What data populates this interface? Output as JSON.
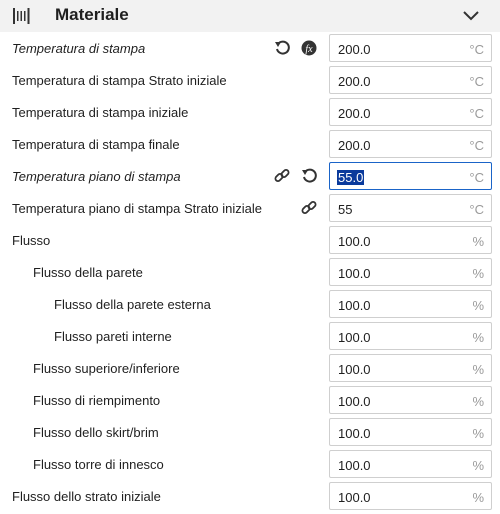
{
  "category": {
    "title": "Materiale",
    "icon": "spool-icon",
    "toggle_icon": "chevron-down-icon"
  },
  "settings": [
    {
      "label": "Temperatura di stampa",
      "value": "200.0",
      "unit": "°C",
      "italic": true,
      "icons": [
        "reset-icon",
        "function-icon"
      ]
    },
    {
      "label": "Temperatura di stampa Strato iniziale",
      "value": "200.0",
      "unit": "°C"
    },
    {
      "label": "Temperatura di stampa iniziale",
      "value": "200.0",
      "unit": "°C"
    },
    {
      "label": "Temperatura di stampa finale",
      "value": "200.0",
      "unit": "°C"
    },
    {
      "label": "Temperatura piano di stampa",
      "value": "55.0",
      "unit": "°C",
      "italic": true,
      "active": true,
      "icons": [
        "link-icon",
        "reset-icon"
      ]
    },
    {
      "label": "Temperatura piano di stampa Strato iniziale",
      "value": "55",
      "unit": "°C",
      "icons": [
        "link-icon"
      ]
    },
    {
      "label": "Flusso",
      "value": "100.0",
      "unit": "%"
    },
    {
      "label": "Flusso della parete",
      "value": "100.0",
      "unit": "%"
    },
    {
      "label": "Flusso della parete esterna",
      "value": "100.0",
      "unit": "%"
    },
    {
      "label": "Flusso pareti interne",
      "value": "100.0",
      "unit": "%"
    },
    {
      "label": "Flusso superiore/inferiore",
      "value": "100.0",
      "unit": "%"
    },
    {
      "label": "Flusso di riempimento",
      "value": "100.0",
      "unit": "%"
    },
    {
      "label": "Flusso dello skirt/brim",
      "value": "100.0",
      "unit": "%"
    },
    {
      "label": "Flusso torre di innesco",
      "value": "100.0",
      "unit": "%"
    },
    {
      "label": "Flusso dello strato iniziale",
      "value": "100.0",
      "unit": "%"
    }
  ]
}
